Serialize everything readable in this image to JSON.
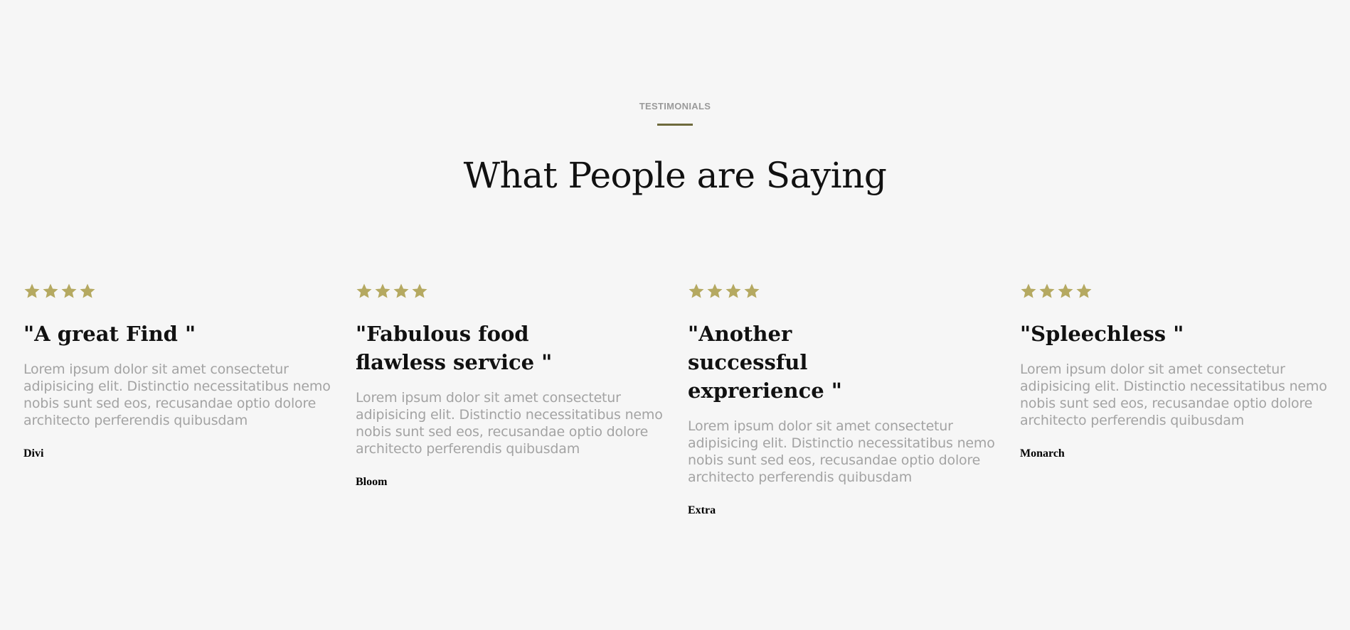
{
  "header": {
    "eyebrow": "TESTIMONIALS",
    "title": "What People are Saying"
  },
  "colors": {
    "star": "#b5a961",
    "accent_rule": "#6e6a3c",
    "background": "#f6f6f6"
  },
  "testimonials": [
    {
      "rating": 4,
      "quote": "\"A great Find \"",
      "text": "Lorem ipsum dolor sit amet consectetur adipisicing elit. Distinctio necessitatibus nemo nobis sunt sed eos, recusandae optio dolore architecto perferendis quibusdam",
      "author": "Divi"
    },
    {
      "rating": 4,
      "quote": "\"Fabulous food flawless service \"",
      "text": "Lorem ipsum dolor sit amet consectetur adipisicing elit. Distinctio necessitatibus nemo nobis sunt sed eos, recusandae optio dolore architecto perferendis quibusdam",
      "author": "Bloom"
    },
    {
      "rating": 4,
      "quote": "\"Another successful exprerience \"",
      "text": "Lorem ipsum dolor sit amet consectetur adipisicing elit. Distinctio necessitatibus nemo nobis sunt sed eos, recusandae optio dolore architecto perferendis quibusdam",
      "author": "Extra"
    },
    {
      "rating": 4,
      "quote": "\"Spleechless \"",
      "text": "Lorem ipsum dolor sit amet consectetur adipisicing elit. Distinctio necessitatibus nemo nobis sunt sed eos, recusandae optio dolore architecto perferendis quibusdam",
      "author": "Monarch"
    }
  ]
}
